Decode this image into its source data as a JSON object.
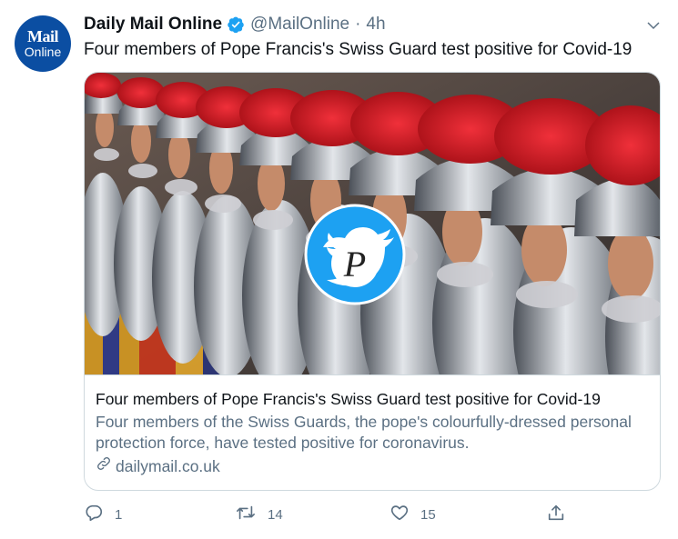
{
  "author": {
    "avatar_line1": "Mail",
    "avatar_line2": "Online",
    "name": "Daily Mail Online",
    "handle": "@MailOnline",
    "separator": "·",
    "time": "4h"
  },
  "tweet": {
    "text": "Four members of Pope Francis's Swiss Guard test positive for Covid-19"
  },
  "card": {
    "title": "Four members of Pope Francis's Swiss Guard test positive for Covid-19",
    "description": "Four members of the Swiss Guards, the pope's colourfully-dressed personal protection force, have tested positive for coronavirus.",
    "domain": "dailymail.co.uk",
    "watermark_letter": "P"
  },
  "actions": {
    "reply_count": "1",
    "retweet_count": "14",
    "like_count": "15"
  },
  "icons": [
    "verified-icon",
    "chevron-down-icon",
    "link-icon",
    "reply-icon",
    "retweet-icon",
    "like-icon",
    "share-icon"
  ],
  "colors": {
    "avatar_bg": "#0b4ea2",
    "verified_blue": "#1da1f2",
    "secondary_text": "#5b7083",
    "plume_red": "#d0121b",
    "watermark_blue": "#1da1f2"
  }
}
